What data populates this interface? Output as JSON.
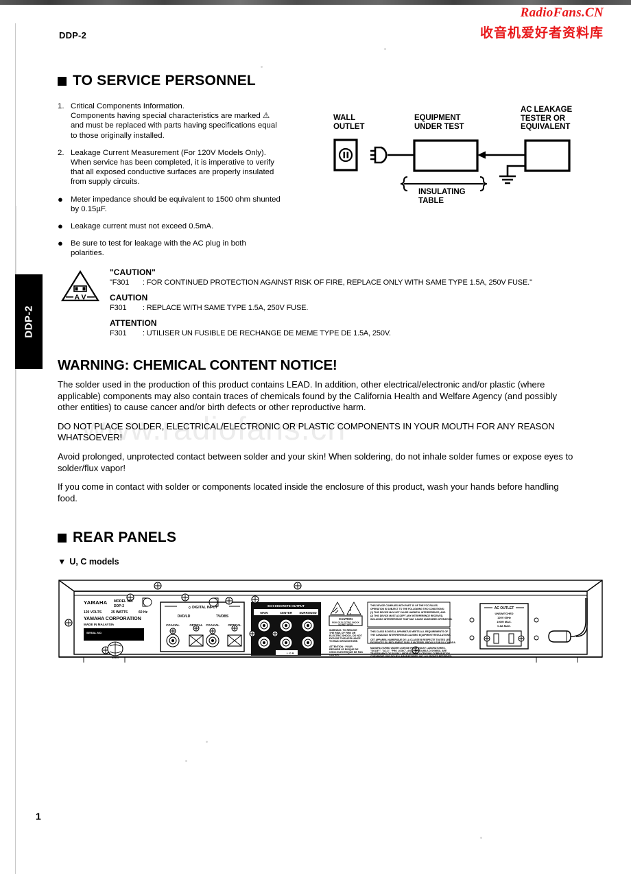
{
  "document": {
    "model_code": "DDP-2",
    "side_tab_label": "DDP-2",
    "page_number": "1"
  },
  "watermark": {
    "line1": "RadioFans.CN",
    "line2": "收音机爱好者资料库",
    "gray": "www.radiofans.cn",
    "color": "#e8191b"
  },
  "service_section": {
    "heading": "TO SERVICE PERSONNEL",
    "items": [
      {
        "marker": "1.",
        "lines": [
          "Critical Components Information.",
          "Components having special characteristics are marked ⚠",
          "and must be replaced with parts having specifications equal",
          "to those originally installed."
        ]
      },
      {
        "marker": "2.",
        "lines": [
          "Leakage Current Measurement (For 120V Models Only).",
          "When service has been completed, it is imperative to verify",
          "that all exposed conductive surfaces are properly insulated",
          "from supply circuits."
        ]
      },
      {
        "marker": "●",
        "lines": [
          "Meter impedance should be equivalent to 1500 ohm shunted",
          "by 0.15µF."
        ]
      },
      {
        "marker": "●",
        "lines": [
          "Leakage current must not exceed 0.5mA."
        ]
      },
      {
        "marker": "●",
        "lines": [
          "Be  sure  to  test  for  leakage  with  the  AC  plug  in  both",
          "polarities."
        ]
      }
    ]
  },
  "leakage_diagram": {
    "wall_outlet": "WALL\nOUTLET",
    "wall_outlet_l1": "WALL",
    "wall_outlet_l2": "OUTLET",
    "equipment_l1": "EQUIPMENT",
    "equipment_l2": "UNDER TEST",
    "tester_l1": "AC LEAKAGE",
    "tester_l2": "TESTER OR",
    "tester_l3": "EQUIVALENT",
    "insulating_l1": "INSULATING",
    "insulating_l2": "TABLE"
  },
  "caution_block": {
    "triangle_label": "A__V",
    "caution_quoted_title": "\"CAUTION\"",
    "caution_quoted_code": "\"F301",
    "caution_quoted_text": ": FOR CONTINUED PROTECTION AGAINST RISK OF FIRE, REPLACE ONLY WITH SAME TYPE 1.5A, 250V FUSE.\"",
    "caution_title": "CAUTION",
    "caution_code": "F301",
    "caution_text": ": REPLACE WITH SAME TYPE 1.5A, 250V FUSE.",
    "attention_title": "ATTENTION",
    "attention_code": "F301",
    "attention_text": ": UTILISER UN FUSIBLE DE RECHANGE DE MEME TYPE DE 1.5A, 250V."
  },
  "chemical_warning": {
    "heading": "WARNING: CHEMICAL CONTENT NOTICE!",
    "paragraphs": [
      "The solder used in the production of this product contains LEAD. In addition, other electrical/electronic and/or plastic (where applicable) components may also contain traces of chemicals found by the California Health and Welfare Agency (and possibly other entities) to cause cancer and/or birth defects or other reproductive harm.",
      "DO NOT PLACE SOLDER, ELECTRICAL/ELECTRONIC OR PLASTIC COMPONENTS IN YOUR MOUTH FOR ANY REASON WHATSOEVER!",
      "Avoid prolonged, unprotected contact between solder and your skin! When soldering, do not inhale solder fumes or expose eyes to solder/flux vapor!",
      "If you come in contact with solder or components located inside the enclosure of this product, wash your hands before handling food."
    ]
  },
  "rear_panels": {
    "heading": "REAR PANELS",
    "subheading": "U, C models",
    "subheading_marker": "▼",
    "panel": {
      "rating_label": {
        "brand": "YAMAHA",
        "model_no_label": "MODEL NO.",
        "model_no": "DDP-2",
        "voltage": "120 VOLTS",
        "watts": "25 WATTS",
        "frequency": "60 Hz",
        "company": "YAMAHA CORPORATION",
        "origin": "MADE IN MALAYSIA"
      },
      "digital_input": {
        "title": "DIGITAL INPUT",
        "groups": [
          {
            "name": "DVD/LD",
            "jacks": [
              "COAXIAL",
              "OPTICAL"
            ]
          },
          {
            "name": "TV/DBS",
            "jacks": [
              "COAXIAL",
              "OPTICAL"
            ]
          }
        ]
      },
      "discrete_output": {
        "title": "6CH DISCRETE OUTPUT",
        "channels": [
          "MAIN",
          "CENTER",
          "SURROUND"
        ]
      },
      "caution_label": {
        "title": "CAUTION",
        "subtitle": "RISK OF ELECTRIC SHOCK\nDO NOT OPEN",
        "warning": "WARNING: TO REDUCE THE RISK OF FIRE OR ELECTRIC SHOCK, DO NOT EXPOSE THIS APPLIANCE TO RAIN OR MOISTURE.",
        "attention": "ATTENTION: POUR REDUIRE LE RISQUE DE CHOC ELECTRIQUE NE PAS OUVRIR."
      },
      "fcc_label": {
        "line1": "THIS DEVICE COMPLIES WITH PART 15 OF THE FCC RULES. OPERATION IS SUBJECT TO THE FOLLOWING TWO CONDITIONS: (1) THIS DEVICE MAY NOT CAUSE HARMFUL INTERFERENCE, AND (2) THIS DEVICE MUST ACCEPT ANY INTERFERENCE RECEIVED, INCLUDING INTERFERENCE THAT MAY CAUSE UNDESIRED OPERATION.",
        "line2": "THIS CLASS B DIGITAL APPARATUS MEETS ALL REQUIREMENTS OF THE CANADIAN INTERFERENCE-CAUSING EQUIPMENT REGULATIONS.",
        "line3": "CET APPAREIL NUMERIQUE DE LA CLASSE B RESPECTE TOUTES LES EXIGENCES DU REGLEMENT SUR LE MATERIEL BROUILLEUR DU CANADA.",
        "line4": "MANUFACTURED UNDER LICENSE FROM DOLBY LABORATORIES. \"DOLBY\", \"AC-3\", \"PRO LOGIC\", AND THE DOUBLE-D SYMBOL ARE TRADEMARKS OF DOLBY LABORATORIES LICENSING CORPORATION. COPYRIGHT 1992 DOLBY LABORATORIES, INC. ALL RIGHTS RESERVED."
      },
      "ac_outlet": {
        "title": "AC OUTLET",
        "l1": "UNSWITCHED",
        "l2": "120V 60Hz",
        "l3": "100W MAX.",
        "l4": "0.8A MAX."
      }
    }
  }
}
